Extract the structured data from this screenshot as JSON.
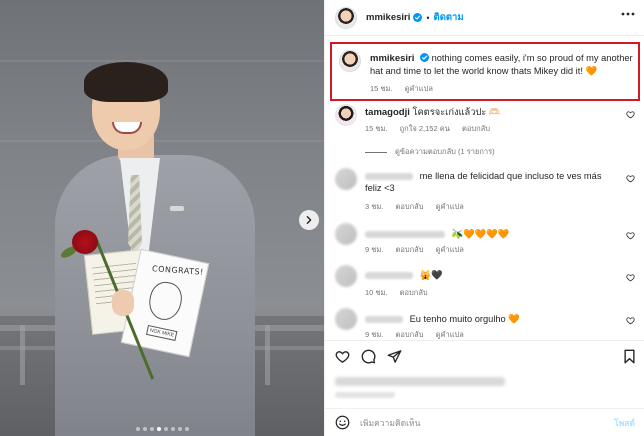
{
  "header": {
    "username": "mmikesiri",
    "follow_label": "ติดตาม",
    "separator": "•"
  },
  "caption": {
    "username": "mmikesiri",
    "text": "nothing comes easily, i'm so proud of my another hat and time to let the world know thats Mikey did it! 🧡",
    "time": "15 ชม.",
    "translate": "ดูคำแปล"
  },
  "comments": [
    {
      "username": "tamagodji",
      "text": "โคตรจะเก่งแล้วปะ 🫶🏻",
      "time": "15 ชม.",
      "likes": "ถูกใจ 2,152 คน",
      "reply": "ตอบกลับ"
    },
    {
      "username": "",
      "text": "me llena de felicidad que incluso te ves más feliz <3",
      "time": "3 ชม.",
      "reply": "ตอบกลับ",
      "translate": "ดูคำแปล"
    },
    {
      "username": "",
      "text": "🫒🧡🧡🧡🧡",
      "time": "9 ชม.",
      "reply": "ตอบกลับ",
      "translate": "ดูคำแปล"
    },
    {
      "username": "",
      "text": "🙀🖤",
      "time": "10 ชม.",
      "reply": "ตอบกลับ"
    },
    {
      "username": "",
      "text": "Eu tenho muito orgulho 🧡",
      "time": "9 ชม.",
      "reply": "ตอบกลับ",
      "translate": "ดูคำแปล"
    }
  ],
  "replies_toggle": "ดูข้อความตอบกลับ (1 รายการ)",
  "photo": {
    "card_title": "CONGRATS!",
    "card_tag": "NOK MIKE",
    "carousel_dots": 8,
    "active_dot": 3
  },
  "add_comment": {
    "placeholder": "เพิ่มความคิดเห็น",
    "post_label": "โพสต์"
  },
  "colors": {
    "accent_blue": "#0095f6",
    "highlight_red": "#d11a26",
    "heart_orange": "#f08a24"
  }
}
